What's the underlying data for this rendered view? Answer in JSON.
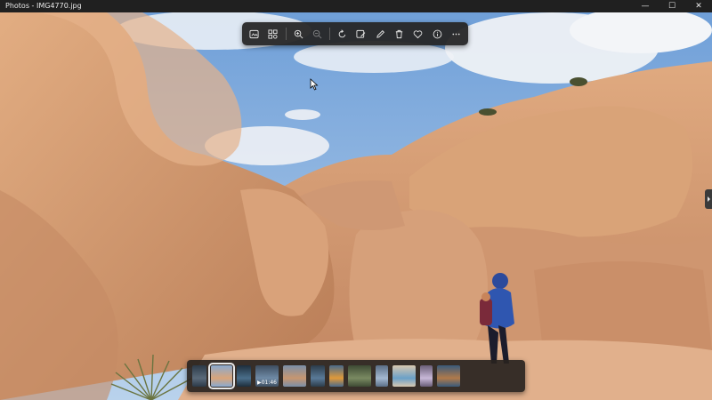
{
  "window": {
    "title": "Photos - IMG4770.jpg",
    "controls": {
      "minimize": "—",
      "maximize": "☐",
      "close": "✕"
    }
  },
  "toolbar": {
    "buttons": [
      {
        "name": "view-actual-size-icon",
        "disabled": false
      },
      {
        "name": "all-photos-grid-icon",
        "disabled": false
      },
      {
        "name": "zoom-in-icon",
        "disabled": false
      },
      {
        "name": "zoom-out-icon",
        "disabled": true
      },
      {
        "name": "rotate-icon",
        "disabled": false
      },
      {
        "name": "edit-image-icon",
        "disabled": false
      },
      {
        "name": "draw-pencil-icon",
        "disabled": false
      },
      {
        "name": "delete-trash-icon",
        "disabled": false
      },
      {
        "name": "favorite-heart-icon",
        "disabled": false
      },
      {
        "name": "info-icon",
        "disabled": false
      },
      {
        "name": "more-options-icon",
        "disabled": false
      }
    ]
  },
  "filmstrip": {
    "selected_index": 1,
    "thumbs": [
      {
        "color1": "#5a6a7a",
        "color2": "#2c3a48",
        "video": false
      },
      {
        "color1": "#d9a57a",
        "color2": "#8aaad0",
        "video": false
      },
      {
        "color1": "#4a6e8a",
        "color2": "#1e2e3c",
        "video": false
      },
      {
        "color1": "#6f8aa6",
        "color2": "#3e4e60",
        "video": true,
        "duration": "01:46"
      },
      {
        "color1": "#c79670",
        "color2": "#7a8fa8",
        "video": false
      },
      {
        "color1": "#5a7a98",
        "color2": "#2c3c4a",
        "video": false
      },
      {
        "color1": "#e09a3a",
        "color2": "#4a6a8a",
        "video": false
      },
      {
        "color1": "#7a8a62",
        "color2": "#3e4a34",
        "video": false
      },
      {
        "color1": "#a4b8d0",
        "color2": "#5a6e86",
        "video": false
      },
      {
        "color1": "#6aa0c8",
        "color2": "#d8c8b0",
        "video": false
      },
      {
        "color1": "#c8b8d8",
        "color2": "#6a5e78",
        "video": false
      },
      {
        "color1": "#b07a4a",
        "color2": "#3a5a7a",
        "video": false
      }
    ]
  },
  "colors": {
    "titlebar": "#202020",
    "toolbar": "#262626",
    "sky": "#8fb6e2",
    "rock": "#d39b72"
  }
}
